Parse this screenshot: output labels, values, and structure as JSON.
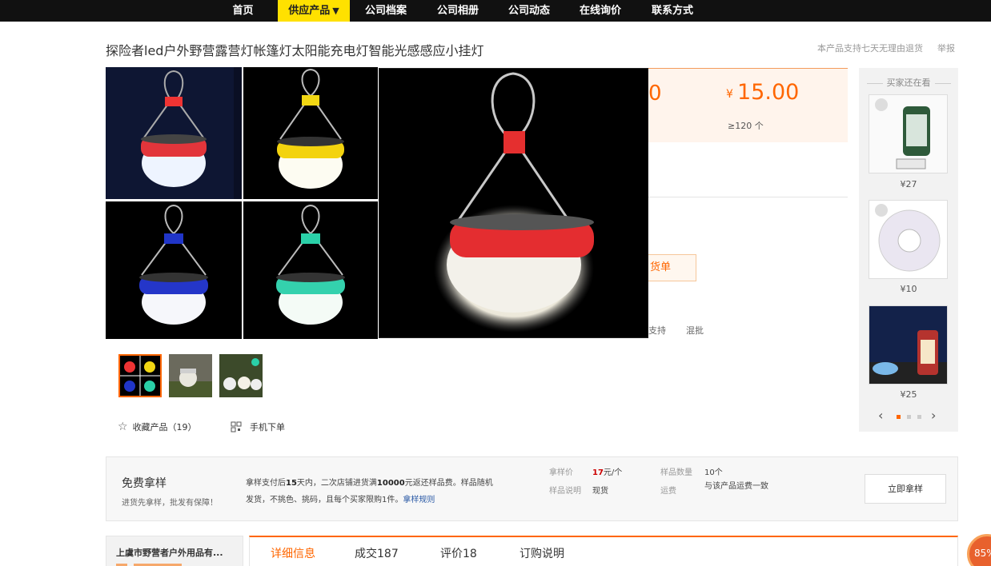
{
  "nav": {
    "items": [
      "首页",
      "供应产品",
      "公司档案",
      "公司相册",
      "公司动态",
      "在线询价",
      "联系方式"
    ],
    "active_index": 1,
    "active_caret": "▼"
  },
  "product": {
    "title": "探险者led户外野营露营灯帐篷灯太阳能充电灯智能光感感应小挂灯",
    "return_note": "本产品支持七天无理由退货",
    "report": "举报"
  },
  "price": {
    "partial_value": "0",
    "currency": "¥",
    "value": "15.00",
    "qty": "≥120 个",
    "goods_btn_partial": "货单",
    "support_partial": "支持",
    "mixed": "混批"
  },
  "actions": {
    "favorite": "收藏产品（19）",
    "mobile_order": "手机下单"
  },
  "side": {
    "title": "买家还在看",
    "items": [
      {
        "price": "¥27"
      },
      {
        "price": "¥10"
      },
      {
        "price": "¥25"
      }
    ]
  },
  "sample": {
    "title": "免费拿样",
    "subtitle": "进货先拿样，批发有保障！",
    "desc_prefix": "拿样支付后",
    "desc_days": "15",
    "desc_mid": "天内，二次店铺进货满",
    "desc_amount": "10000",
    "desc_suffix": "元返还样品费。样品随机发货，不挑色、挑码，且每个买家限购1件。",
    "rules_link": "拿样规则",
    "price_label": "拿样价",
    "price_num": "17",
    "price_unit": "元/个",
    "qty_label": "样品数量",
    "qty_value": "10个",
    "note_label": "样品说明",
    "note_value": "现货",
    "fee_label": "运费",
    "fee_value": "与该产品运费一致",
    "button": "立即拿样"
  },
  "shop": {
    "name": "上虞市野营者户外用品有..."
  },
  "tabs": [
    "详细信息",
    "成交187",
    "评价18",
    "订购说明"
  ],
  "float": {
    "text": "85%"
  },
  "colors": {
    "accent": "#ff6600",
    "nav_bg": "#111111",
    "nav_active": "#ffe100"
  }
}
